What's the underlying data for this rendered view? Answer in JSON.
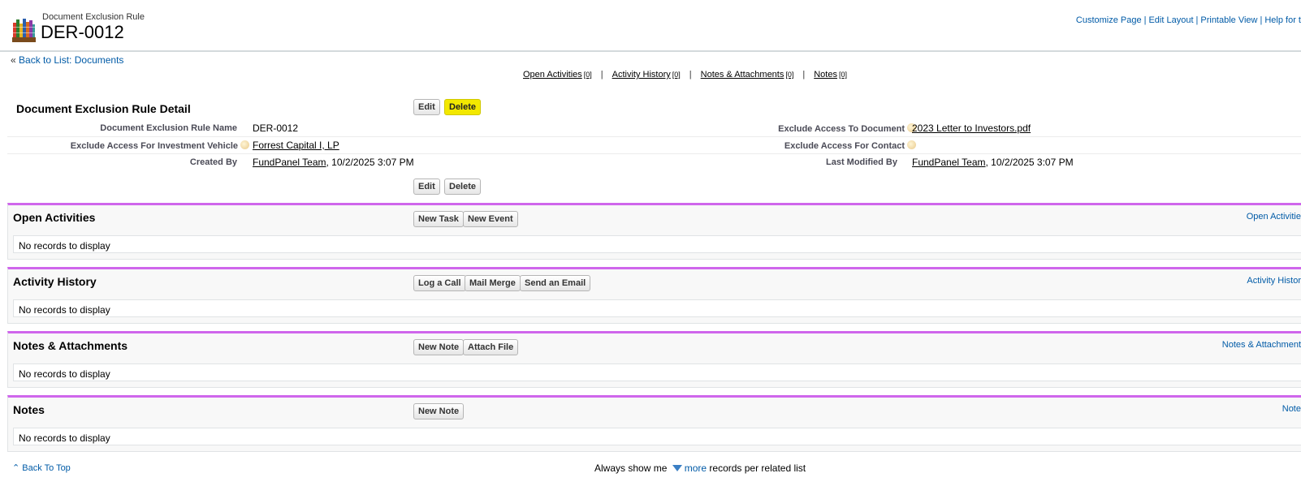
{
  "header": {
    "object_type": "Document Exclusion Rule",
    "record_name": "DER-0012",
    "links": [
      "Customize Page",
      "Edit Layout",
      "Printable View",
      "Help for t"
    ]
  },
  "nav": {
    "back_prefix": "«",
    "back_label": "Back to List: Documents"
  },
  "related_links": [
    {
      "label": "Open Activities",
      "count": "[0]"
    },
    {
      "label": "Activity History",
      "count": "[0]"
    },
    {
      "label": "Notes & Attachments",
      "count": "[0]"
    },
    {
      "label": "Notes",
      "count": "[0]"
    }
  ],
  "detail": {
    "title": "Document Exclusion Rule Detail",
    "edit_label": "Edit",
    "delete_label": "Delete",
    "fields": {
      "name_label": "Document Exclusion Rule Name",
      "name_value": "DER-0012",
      "document_label": "Exclude Access To Document",
      "document_value": "2023 Letter to Investors.pdf",
      "vehicle_label": "Exclude Access For Investment Vehicle",
      "vehicle_value": "Forrest Capital I, LP",
      "contact_label": "Exclude Access For Contact",
      "contact_value": "",
      "created_label": "Created By",
      "created_user": "FundPanel Team",
      "created_date": ", 10/2/2025 3:07 PM",
      "modified_label": "Last Modified By",
      "modified_user": "FundPanel Team",
      "modified_date": ", 10/2/2025 3:07 PM"
    }
  },
  "related_lists": {
    "open_activities": {
      "title": "Open Activities",
      "buttons": [
        "New Task",
        "New Event"
      ],
      "help": "Open Activitie",
      "empty": "No records to display"
    },
    "activity_history": {
      "title": "Activity History",
      "buttons": [
        "Log a Call",
        "Mail Merge",
        "Send an Email"
      ],
      "help": "Activity Histor",
      "empty": "No records to display"
    },
    "notes_attachments": {
      "title": "Notes & Attachments",
      "buttons": [
        "New Note",
        "Attach File"
      ],
      "help": "Notes & Attachment",
      "empty": "No records to display"
    },
    "notes": {
      "title": "Notes",
      "buttons": [
        "New Note"
      ],
      "help": "Note",
      "empty": "No records to display"
    }
  },
  "footer": {
    "back_to_top": "Back To Top",
    "show_prefix": "Always show me",
    "more": "more",
    "show_suffix": "records per related list"
  },
  "colors": {
    "link": "#015ba7",
    "related_list_accent": "#cf66ec",
    "highlight": "#f3e800"
  }
}
